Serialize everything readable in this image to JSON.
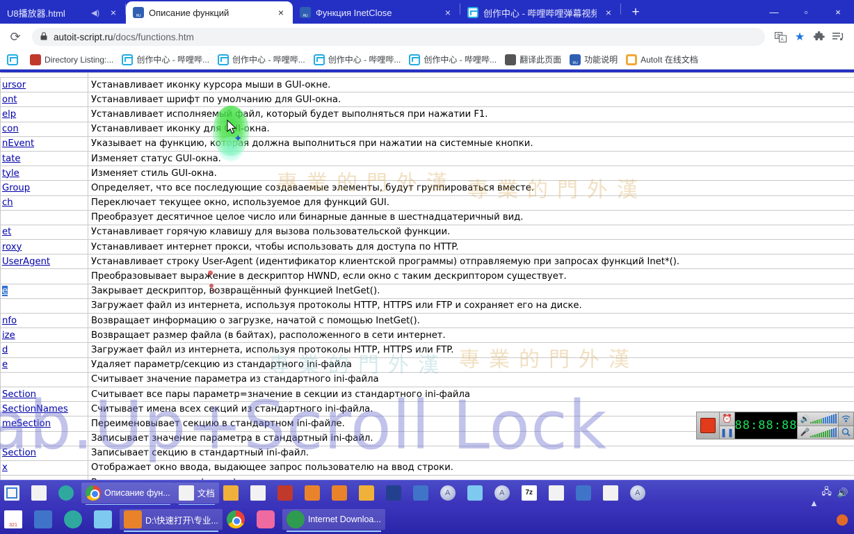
{
  "browser": {
    "tabs": [
      {
        "title": "U8播放器.html",
        "favicon": "bili-icon",
        "active": false,
        "audio": true,
        "close": "×"
      },
      {
        "title": "Описание функций",
        "favicon": "ru-doc-icon",
        "active": true,
        "audio": false,
        "close": "×"
      },
      {
        "title": "Функция InetClose",
        "favicon": "ru-doc-icon",
        "active": false,
        "audio": false,
        "close": "×"
      },
      {
        "title": "创作中心 - 哔哩哔哩弹幕视频网",
        "favicon": "bili-icon",
        "active": false,
        "audio": false,
        "close": "×"
      }
    ],
    "new_tab_label": "+",
    "window_controls": {
      "minimize": "—",
      "maximize": "▫",
      "close": "×"
    },
    "toolbar": {
      "reload_icon": "⟳",
      "lock_icon": "🔒",
      "url_host": "autoit-script.ru",
      "url_path": "/docs/functions.htm",
      "translate_icon": "translate-icon",
      "bookmark_star_icon": "★",
      "extensions_icon": "🧩",
      "menu_icon": "≡"
    },
    "bookmarks": [
      {
        "label": "",
        "icon": "bili-icon"
      },
      {
        "label": "Directory Listing:...",
        "icon": "red-icon"
      },
      {
        "label": "创作中心 - 哔哩哔...",
        "icon": "bili-icon"
      },
      {
        "label": "创作中心 - 哔哩哔...",
        "icon": "bili-icon"
      },
      {
        "label": "创作中心 - 哔哩哔...",
        "icon": "bili-icon"
      },
      {
        "label": "创作中心 - 哔哩哔...",
        "icon": "bili-icon"
      },
      {
        "label": "翻译此页面",
        "icon": "globe-icon"
      },
      {
        "label": "功能说明",
        "icon": "ru-doc-icon"
      },
      {
        "label": "AutoIt 在线文档",
        "icon": "doc-icon"
      }
    ]
  },
  "page": {
    "rows": [
      {
        "name": "ursor",
        "desc": "Устанавливает иконку курсора мыши в GUI-окне."
      },
      {
        "name": "ont",
        "desc": "Устанавливает шрифт по умолчанию для GUI-окна."
      },
      {
        "name": "elp",
        "desc": "Устанавливает исполняемый файл, который будет выполняться при нажатии F1."
      },
      {
        "name": "con",
        "desc": "Устанавливает иконку для GUI-окна."
      },
      {
        "name": "nEvent",
        "desc": "Указывает на функцию, которая должна выполниться при нажатии на системные кнопки."
      },
      {
        "name": "tate",
        "desc": "Изменяет статус GUI-окна."
      },
      {
        "name": "tyle",
        "desc": "Изменяет стиль GUI-окна."
      },
      {
        "name": "Group",
        "desc": "Определяет, что все последующие создаваемые элементы, будут группироваться вместе."
      },
      {
        "name": "ch",
        "desc": "Переключает текущее окно, используемое для функций GUI."
      },
      {
        "name": "",
        "desc": "Преобразует десятичное целое число или бинарные данные в шестнадцатеричный вид."
      },
      {
        "name": "et",
        "desc": "Устанавливает горячую клавишу для вызова пользовательской функции."
      },
      {
        "name": "roxy",
        "desc": "Устанавливает интернет прокси, чтобы использовать для доступа по HTTP."
      },
      {
        "name": "UserAgent",
        "desc": "Устанавливает строку User-Agent (идентификатор клиентской программы) отправляемую при запросах функций Inet*()."
      },
      {
        "name": "",
        "desc": "Преобразовывает выражение в дескриптор HWND, если окно с таким дескриптором существует."
      },
      {
        "name": "e",
        "desc": "Закрывает дескриптор, возвращённый функцией InetGet().",
        "selected": true
      },
      {
        "name": "",
        "desc": "Загружает файл из интернета, используя протоколы HTTP, HTTPS или FTP и сохраняет его на диске."
      },
      {
        "name": "nfo",
        "desc": "Возвращает информацию о загрузке, начатой с помощью InetGet()."
      },
      {
        "name": "ize",
        "desc": "Возвращает размер файла (в байтах), расположенного в сети интернет."
      },
      {
        "name": "d",
        "desc": "Загружает файл из интернета, используя протоколы HTTP, HTTPS или FTP."
      },
      {
        "name": "e",
        "desc": "Удаляет параметр/секцию из стандартного ini-файла"
      },
      {
        "name": "",
        "desc": "Считывает значение параметра из стандартного ini-файла"
      },
      {
        "name": "Section",
        "desc": "Считывает все пары параметр=значение в секции из стандартного ini-файла"
      },
      {
        "name": "SectionNames",
        "desc": "Считывает имена всех секций из стандартного ini-файла."
      },
      {
        "name": "meSection",
        "desc": "Переименовывает секцию в стандартном ini-файле."
      },
      {
        "name": "",
        "desc": "Записывает значение параметра в стандартный ini-файл."
      },
      {
        "name": "Section",
        "desc": "Записывает секцию в стандартный ini-файл."
      },
      {
        "name": "x",
        "desc": "Отображает окно ввода, выдающее запрос пользователю на ввод строки."
      },
      {
        "name": "",
        "desc": "Возвращает числовое (целое) представление выражения."
      }
    ]
  },
  "overlays": {
    "watermark_main": "ab.Up+Scroll Lock",
    "watermark_cn_1": "專業的門外漢",
    "watermark_cn_2": "專業的門外漢",
    "watermark_cn_3": "專業的門外漢",
    "watermark_cn_4": "專業的門外漢",
    "cursor_icon": "mouse-cursor-arrow",
    "highlight_color": "#3cdc3c"
  },
  "mixer": {
    "stop_button_label": "stop-icon",
    "alarm_icon": "⏰",
    "pause_icon": "❚❚",
    "lcd_value": "88:88:88",
    "speaker_icon": "🔊",
    "mic_icon": "🎤",
    "wifi_icon": "wifi-icon",
    "search_icon": "magnifier-icon"
  },
  "taskbar_top": {
    "items": [
      {
        "label": "",
        "icon": "wps-icon"
      },
      {
        "label": "",
        "icon": "seal-icon"
      },
      {
        "label": "",
        "icon": "shield-icon"
      },
      {
        "label": "Описание фун...",
        "icon": "chrome-icon",
        "window": true
      },
      {
        "label": "文档",
        "icon": "document-icon",
        "window": true
      },
      {
        "label": "",
        "icon": "folder-search-icon"
      },
      {
        "label": "",
        "icon": "window-tool-icon"
      },
      {
        "label": "",
        "icon": "red-dot-icon"
      },
      {
        "label": "",
        "icon": "search-icon"
      },
      {
        "label": "",
        "icon": "ring-icon"
      },
      {
        "label": "",
        "icon": "folder-icon"
      },
      {
        "label": "",
        "icon": "grid-icon"
      },
      {
        "label": "",
        "icon": "person-blue-icon"
      },
      {
        "label": "",
        "icon": "autoit-icon"
      },
      {
        "label": "",
        "icon": "notepad-icon"
      },
      {
        "label": "",
        "icon": "autoit-icon"
      },
      {
        "label": "",
        "icon": "7zip-icon"
      },
      {
        "label": "",
        "icon": "pen-icon"
      },
      {
        "label": "",
        "icon": "blue-panel-icon"
      },
      {
        "label": "",
        "icon": "r-icon"
      },
      {
        "label": "",
        "icon": "autoit-icon"
      }
    ],
    "tray": {
      "network_icon": "🖧",
      "volume_icon": "🔊"
    }
  },
  "taskbar_bottom": {
    "items": [
      {
        "label": "",
        "icon": "calendar-icon"
      },
      {
        "label": "",
        "icon": "book-icon"
      },
      {
        "label": "",
        "icon": "atom-icon"
      },
      {
        "label": "",
        "icon": "bird-icon"
      },
      {
        "label": "D:\\快速打开\\专业...",
        "icon": "folder-orange-icon",
        "window": true
      },
      {
        "label": "",
        "icon": "chrome-icon"
      },
      {
        "label": "",
        "icon": "bili-app-icon"
      },
      {
        "label": "Internet Downloa...",
        "icon": "idm-icon",
        "window": true
      }
    ],
    "show_hidden_icon": "▲",
    "tray_right_icon": "⬤"
  }
}
